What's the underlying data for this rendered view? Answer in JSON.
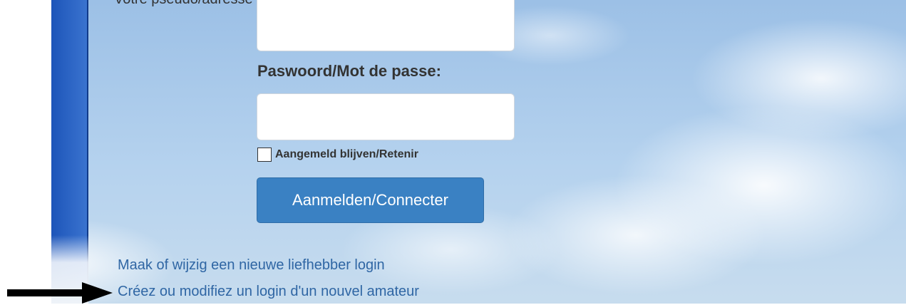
{
  "login": {
    "top_text": "Votre pseudo/adresse e-mail ou votre login d'amateur:",
    "username_value": "",
    "password_label": "Paswoord/Mot de passe:",
    "password_value": "",
    "remember_label": "Aangemeld blijven/Retenir",
    "remember_checked": false,
    "submit_label": "Aanmelden/Connecter"
  },
  "links": {
    "create_nl": "Maak of wijzig een nieuwe liefhebber login",
    "create_fr": "Créez ou modifiez un login d'un nouvel amateur"
  },
  "colors": {
    "button": "#3a81c3",
    "link": "#2f66a4",
    "side_bar": "#1d55b9"
  },
  "icons": {
    "arrow": "arrow-right-icon"
  }
}
